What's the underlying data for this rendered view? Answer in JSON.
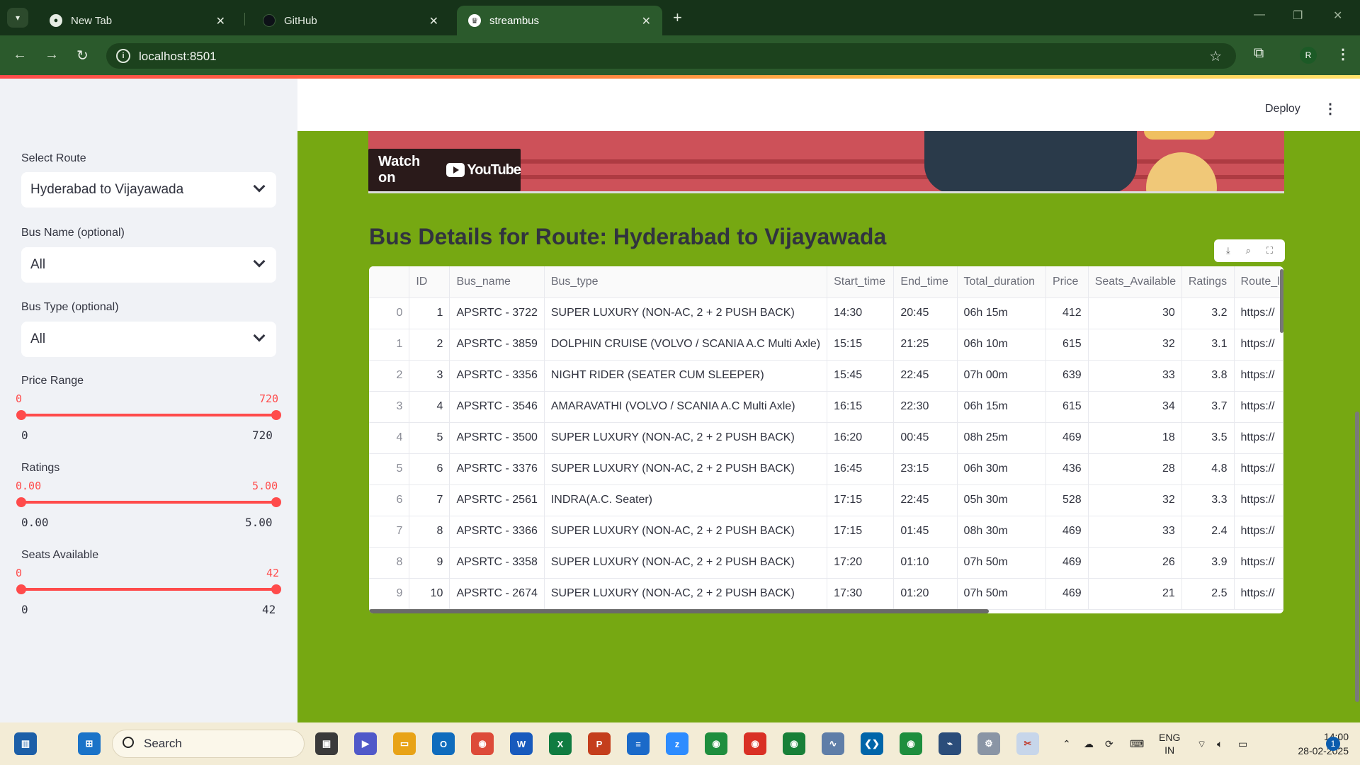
{
  "browser": {
    "tabs": [
      {
        "title": "New Tab"
      },
      {
        "title": "GitHub"
      },
      {
        "title": "streambus"
      }
    ],
    "url": "localhost:8501",
    "profile_initial": "R"
  },
  "app_header": {
    "deploy_label": "Deploy"
  },
  "sidebar": {
    "route_label": "Select Route",
    "route_value": "Hyderabad to Vijayawada",
    "bus_name_label": "Bus Name (optional)",
    "bus_name_value": "All",
    "bus_type_label": "Bus Type (optional)",
    "bus_type_value": "All",
    "price": {
      "label": "Price Range",
      "low": "0",
      "high": "720",
      "min": "0",
      "max": "720"
    },
    "ratings": {
      "label": "Ratings",
      "low": "0.00",
      "high": "5.00",
      "min": "0.00",
      "max": "5.00"
    },
    "seats": {
      "label": "Seats Available",
      "low": "0",
      "high": "42",
      "min": "0",
      "max": "42"
    }
  },
  "video": {
    "watch_on": "Watch on",
    "brand": "YouTube"
  },
  "main": {
    "title": "Bus Details for Route: Hyderabad to Vijayawada"
  },
  "table": {
    "columns": [
      "",
      "ID",
      "Bus_name",
      "Bus_type",
      "Start_time",
      "End_time",
      "Total_duration",
      "Price",
      "Seats_Available",
      "Ratings",
      "Route_l"
    ],
    "rows": [
      [
        "0",
        "1",
        "APSRTC - 3722",
        "SUPER LUXURY (NON-AC, 2 + 2 PUSH BACK)",
        "14:30",
        "20:45",
        "06h 15m",
        "412",
        "30",
        "3.2",
        "https://"
      ],
      [
        "1",
        "2",
        "APSRTC - 3859",
        "DOLPHIN CRUISE (VOLVO / SCANIA A.C Multi Axle)",
        "15:15",
        "21:25",
        "06h 10m",
        "615",
        "32",
        "3.1",
        "https://"
      ],
      [
        "2",
        "3",
        "APSRTC - 3356",
        "NIGHT RIDER (SEATER CUM SLEEPER)",
        "15:45",
        "22:45",
        "07h 00m",
        "639",
        "33",
        "3.8",
        "https://"
      ],
      [
        "3",
        "4",
        "APSRTC - 3546",
        "AMARAVATHI (VOLVO / SCANIA A.C Multi Axle)",
        "16:15",
        "22:30",
        "06h 15m",
        "615",
        "34",
        "3.7",
        "https://"
      ],
      [
        "4",
        "5",
        "APSRTC - 3500",
        "SUPER LUXURY (NON-AC, 2 + 2 PUSH BACK)",
        "16:20",
        "00:45",
        "08h 25m",
        "469",
        "18",
        "3.5",
        "https://"
      ],
      [
        "5",
        "6",
        "APSRTC - 3376",
        "SUPER LUXURY (NON-AC, 2 + 2 PUSH BACK)",
        "16:45",
        "23:15",
        "06h 30m",
        "436",
        "28",
        "4.8",
        "https://"
      ],
      [
        "6",
        "7",
        "APSRTC - 2561",
        "INDRA(A.C. Seater)",
        "17:15",
        "22:45",
        "05h 30m",
        "528",
        "32",
        "3.3",
        "https://"
      ],
      [
        "7",
        "8",
        "APSRTC - 3366",
        "SUPER LUXURY (NON-AC, 2 + 2 PUSH BACK)",
        "17:15",
        "01:45",
        "08h 30m",
        "469",
        "33",
        "2.4",
        "https://"
      ],
      [
        "8",
        "9",
        "APSRTC - 3358",
        "SUPER LUXURY (NON-AC, 2 + 2 PUSH BACK)",
        "17:20",
        "01:10",
        "07h 50m",
        "469",
        "26",
        "3.9",
        "https://"
      ],
      [
        "9",
        "10",
        "APSRTC - 2674",
        "SUPER LUXURY (NON-AC, 2 + 2 PUSH BACK)",
        "17:30",
        "01:20",
        "07h 50m",
        "469",
        "21",
        "2.5",
        "https://"
      ]
    ]
  },
  "taskbar": {
    "search_placeholder": "Search",
    "lang_top": "ENG",
    "lang_bottom": "IN",
    "time": "14:00",
    "date": "28-02-2025",
    "notification_count": "1"
  },
  "colors": {
    "accent": "#ff4b4b",
    "main_bg": "#76a812",
    "sidebar_bg": "#f0f2f6",
    "chrome_frame": "#2b5a2c"
  }
}
